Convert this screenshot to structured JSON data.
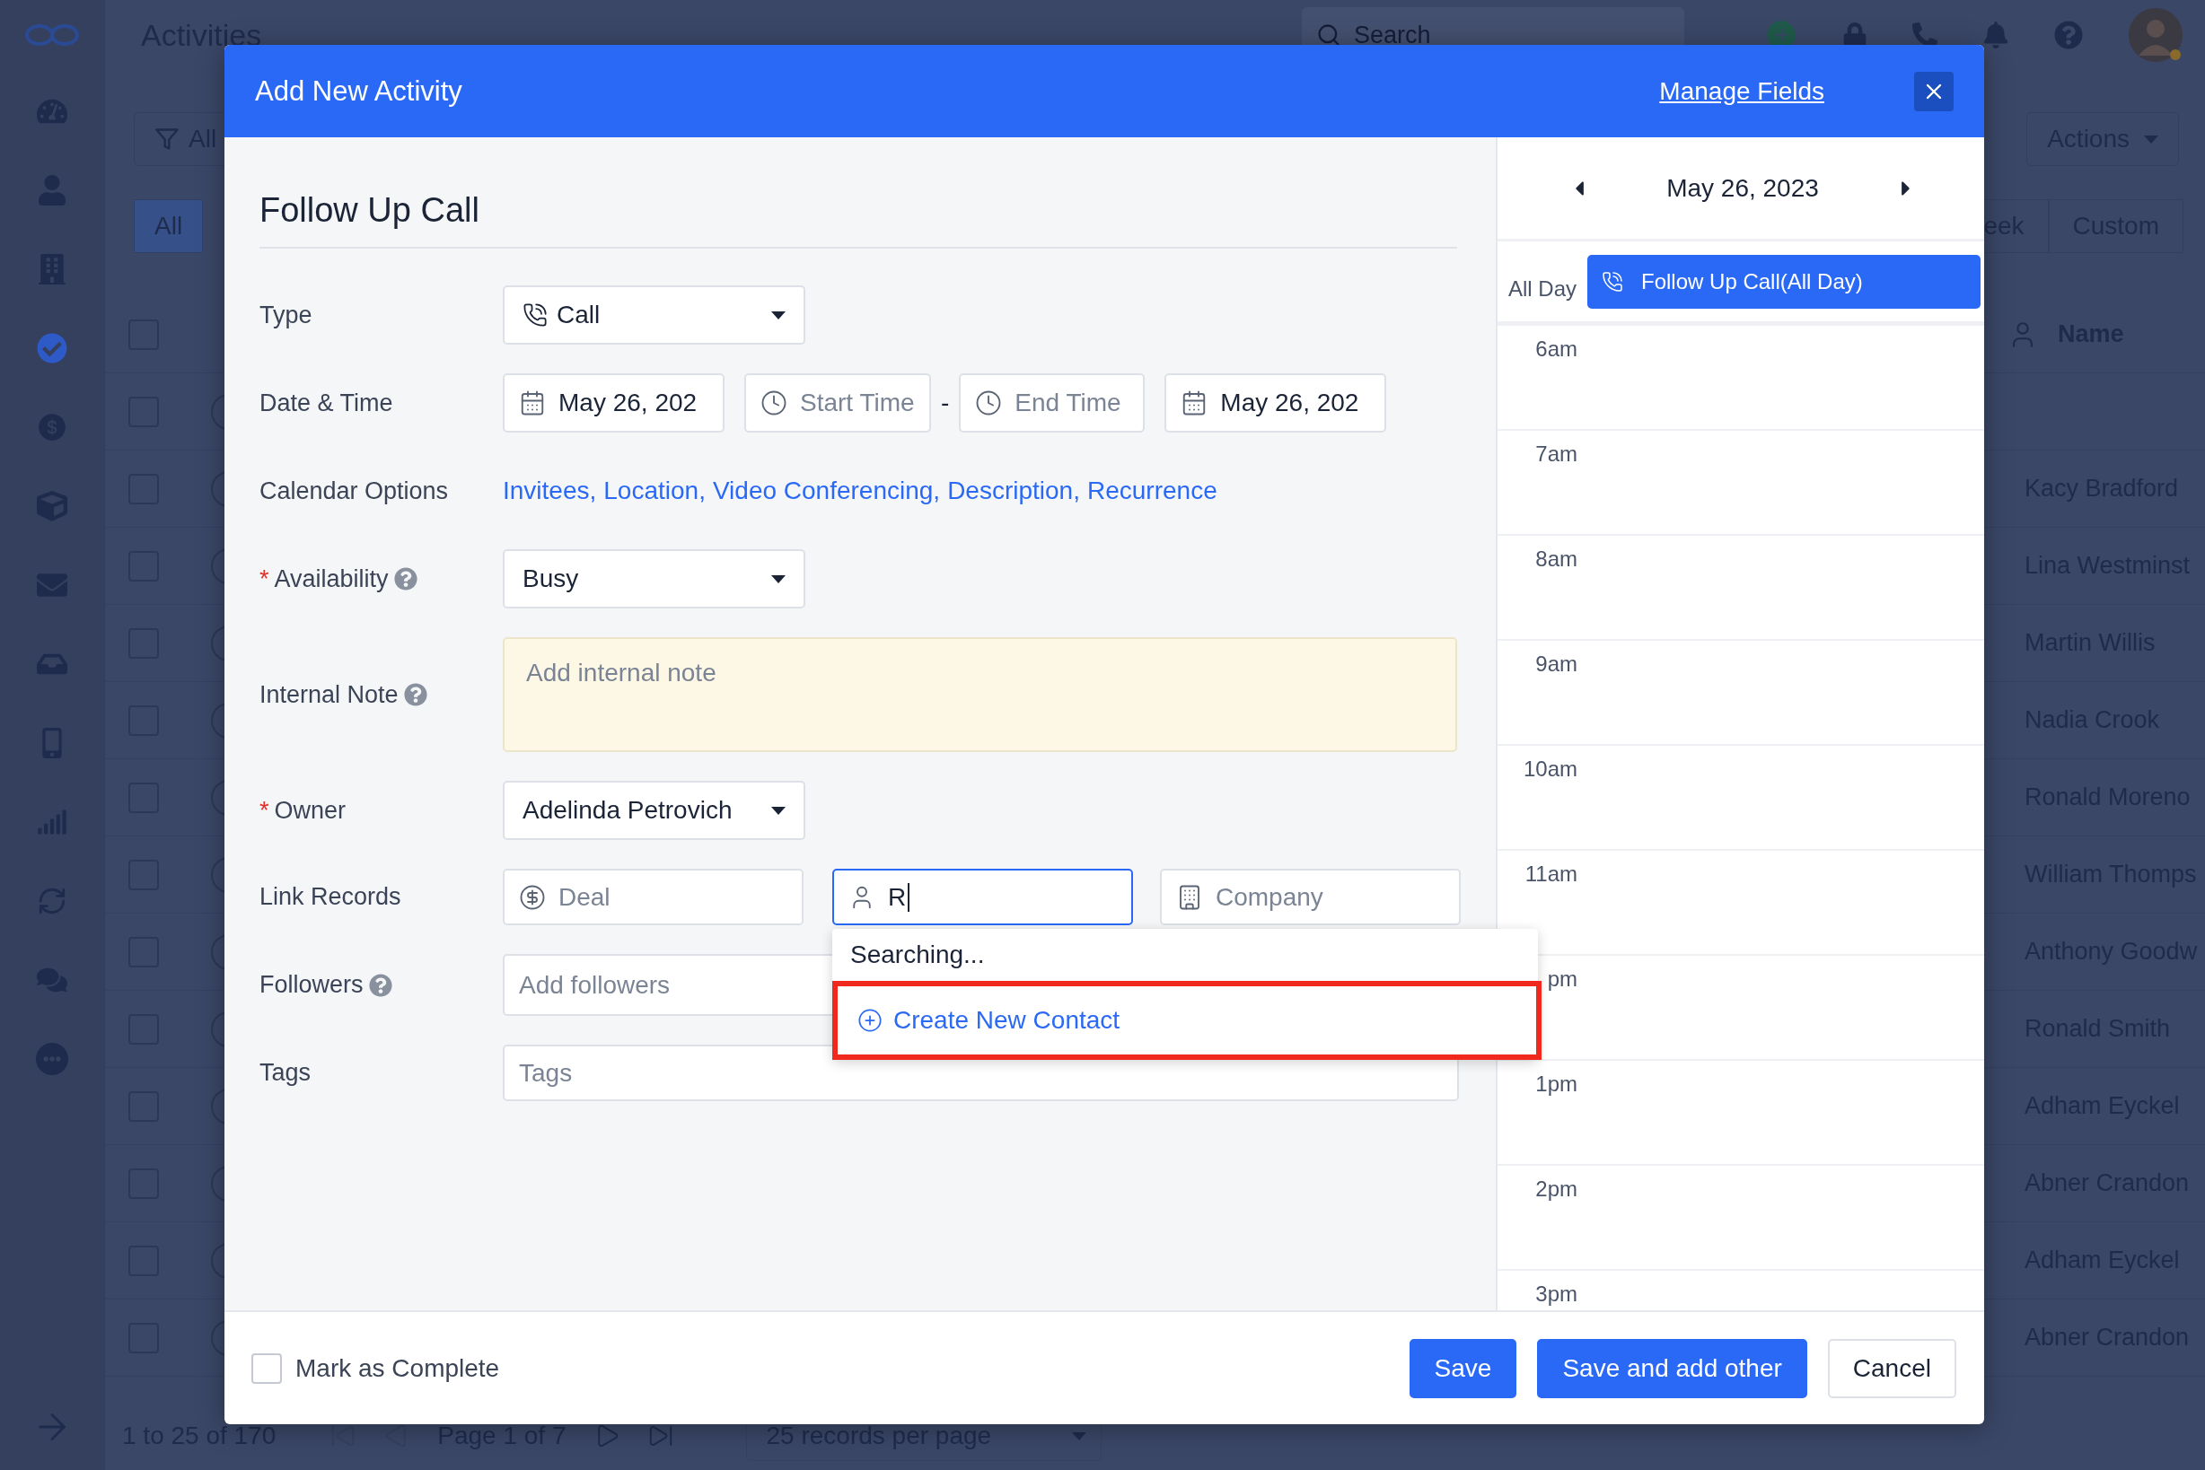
{
  "app": {
    "title": "Activities",
    "search": {
      "placeholder": "Search"
    },
    "sidebar": {
      "items": [
        {
          "selected": false
        },
        {
          "selected": false
        },
        {
          "selected": false
        },
        {
          "selected": true
        },
        {
          "selected": false
        },
        {
          "selected": false
        },
        {
          "selected": false
        },
        {
          "selected": false
        },
        {
          "selected": false
        },
        {
          "selected": false
        },
        {
          "selected": false
        },
        {
          "selected": false
        },
        {
          "selected": false
        }
      ]
    },
    "filter": {
      "label": "All"
    },
    "actions": {
      "label": "Actions"
    },
    "view_tabs": [
      {
        "label": "All",
        "selected": true
      },
      {
        "label": "eek",
        "selected": false
      },
      {
        "label": "Custom",
        "selected": false
      }
    ],
    "table": {
      "header_checked": false,
      "columns": [
        {
          "label": "Name"
        }
      ],
      "rows": [
        {
          "checked": false
        },
        {
          "checked": false,
          "name": "Kacy Bradford"
        },
        {
          "checked": false,
          "name": "Lina Westminst"
        },
        {
          "checked": false,
          "name": "Martin Willis"
        },
        {
          "checked": false,
          "name": "Nadia Crook"
        },
        {
          "checked": false,
          "name": "Ronald Moreno"
        },
        {
          "checked": false,
          "name": "William Thomps"
        },
        {
          "checked": false,
          "name": "Anthony Goodw"
        },
        {
          "checked": false,
          "name": "Ronald Smith"
        },
        {
          "checked": false,
          "name": "Adham Eyckel"
        },
        {
          "checked": false,
          "name": "Abner Crandon"
        },
        {
          "checked": false,
          "name": "Adham Eyckel"
        },
        {
          "checked": false,
          "name": "Abner Crandon"
        }
      ]
    },
    "pagination": {
      "summary": "1 to 25 of 170",
      "page": "Page 1 of 7",
      "page_size": "25 records per page"
    }
  },
  "modal": {
    "title": "Add New Activity",
    "manage_fields": "Manage Fields",
    "heading": "Follow Up Call",
    "form": {
      "type": {
        "label": "Type",
        "value": "Call"
      },
      "date_time": {
        "label": "Date & Time",
        "start_date": "May 26, 202",
        "start_time_placeholder": "Start Time",
        "separator": "-",
        "end_time_placeholder": "End Time",
        "end_date": "May 26, 202"
      },
      "calendar_options": {
        "label": "Calendar Options",
        "links": [
          "Invitees,",
          "Location,",
          "Video Conferencing,",
          "Description,",
          "Recurrence"
        ]
      },
      "availability": {
        "label": "Availability",
        "required_mark": "*",
        "help": true,
        "value": "Busy"
      },
      "internal_note": {
        "label": "Internal Note",
        "help": true,
        "placeholder": "Add internal note"
      },
      "owner": {
        "label": "Owner",
        "required_mark": "*",
        "value": "Adelinda Petrovich"
      },
      "link_records": {
        "label": "Link Records",
        "deal_placeholder": "Deal",
        "contact_value": "R",
        "contact_focused": true,
        "company_placeholder": "Company",
        "dropdown": {
          "status": "Searching...",
          "action": {
            "label": "Create New Contact",
            "highlighted": true
          }
        }
      },
      "followers": {
        "label": "Followers",
        "help": true,
        "placeholder": "Add followers"
      },
      "tags": {
        "label": "Tags",
        "placeholder": "Tags"
      }
    },
    "calendar": {
      "date": "May 26, 2023",
      "all_day_label": "All Day",
      "events": [
        {
          "title": "Follow Up Call(All Day)"
        }
      ],
      "hours": [
        "6am",
        "7am",
        "8am",
        "9am",
        "10am",
        "11am",
        "pm",
        "1pm",
        "2pm",
        "3pm"
      ]
    },
    "footer": {
      "complete": {
        "label": "Mark as Complete",
        "checked": false
      },
      "buttons": [
        {
          "label": "Save",
          "kind": "primary"
        },
        {
          "label": "Save and add other",
          "kind": "primary"
        },
        {
          "label": "Cancel",
          "kind": "secondary"
        }
      ]
    }
  }
}
